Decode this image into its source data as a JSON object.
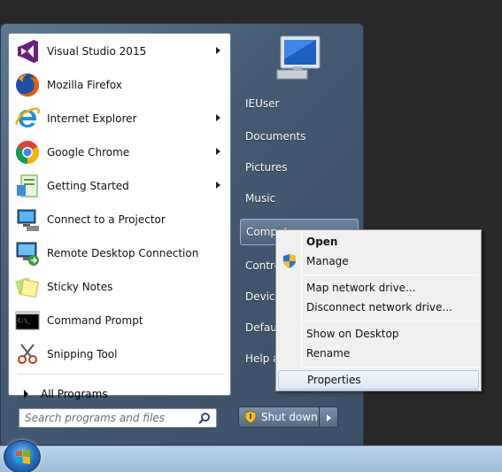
{
  "programs": [
    {
      "label": "Visual Studio 2015",
      "icon": "visual-studio-icon",
      "submenu": true
    },
    {
      "label": "Mozilla Firefox",
      "icon": "firefox-icon",
      "submenu": false
    },
    {
      "label": "Internet Explorer",
      "icon": "internet-explorer-icon",
      "submenu": true
    },
    {
      "label": "Google Chrome",
      "icon": "chrome-icon",
      "submenu": true
    },
    {
      "label": "Getting Started",
      "icon": "getting-started-icon",
      "submenu": true
    },
    {
      "label": "Connect to a Projector",
      "icon": "projector-icon",
      "submenu": false
    },
    {
      "label": "Remote Desktop Connection",
      "icon": "remote-desktop-icon",
      "submenu": false
    },
    {
      "label": "Sticky Notes",
      "icon": "sticky-notes-icon",
      "submenu": false
    },
    {
      "label": "Command Prompt",
      "icon": "command-prompt-icon",
      "submenu": false
    },
    {
      "label": "Snipping Tool",
      "icon": "snipping-tool-icon",
      "submenu": false
    }
  ],
  "all_programs_label": "All Programs",
  "search": {
    "placeholder": "Search programs and files"
  },
  "right_links": {
    "user": "IEUser",
    "documents": "Documents",
    "pictures": "Pictures",
    "music": "Music",
    "computer": "Comput",
    "control_panel": "Contro",
    "devices": "Device",
    "default_programs": "Default",
    "help": "Help a"
  },
  "shutdown_label": "Shut down",
  "context_menu": {
    "open": "Open",
    "manage": "Manage",
    "map_drive": "Map network drive...",
    "disconnect_drive": "Disconnect network drive...",
    "show_desktop": "Show on Desktop",
    "rename": "Rename",
    "properties": "Properties"
  }
}
